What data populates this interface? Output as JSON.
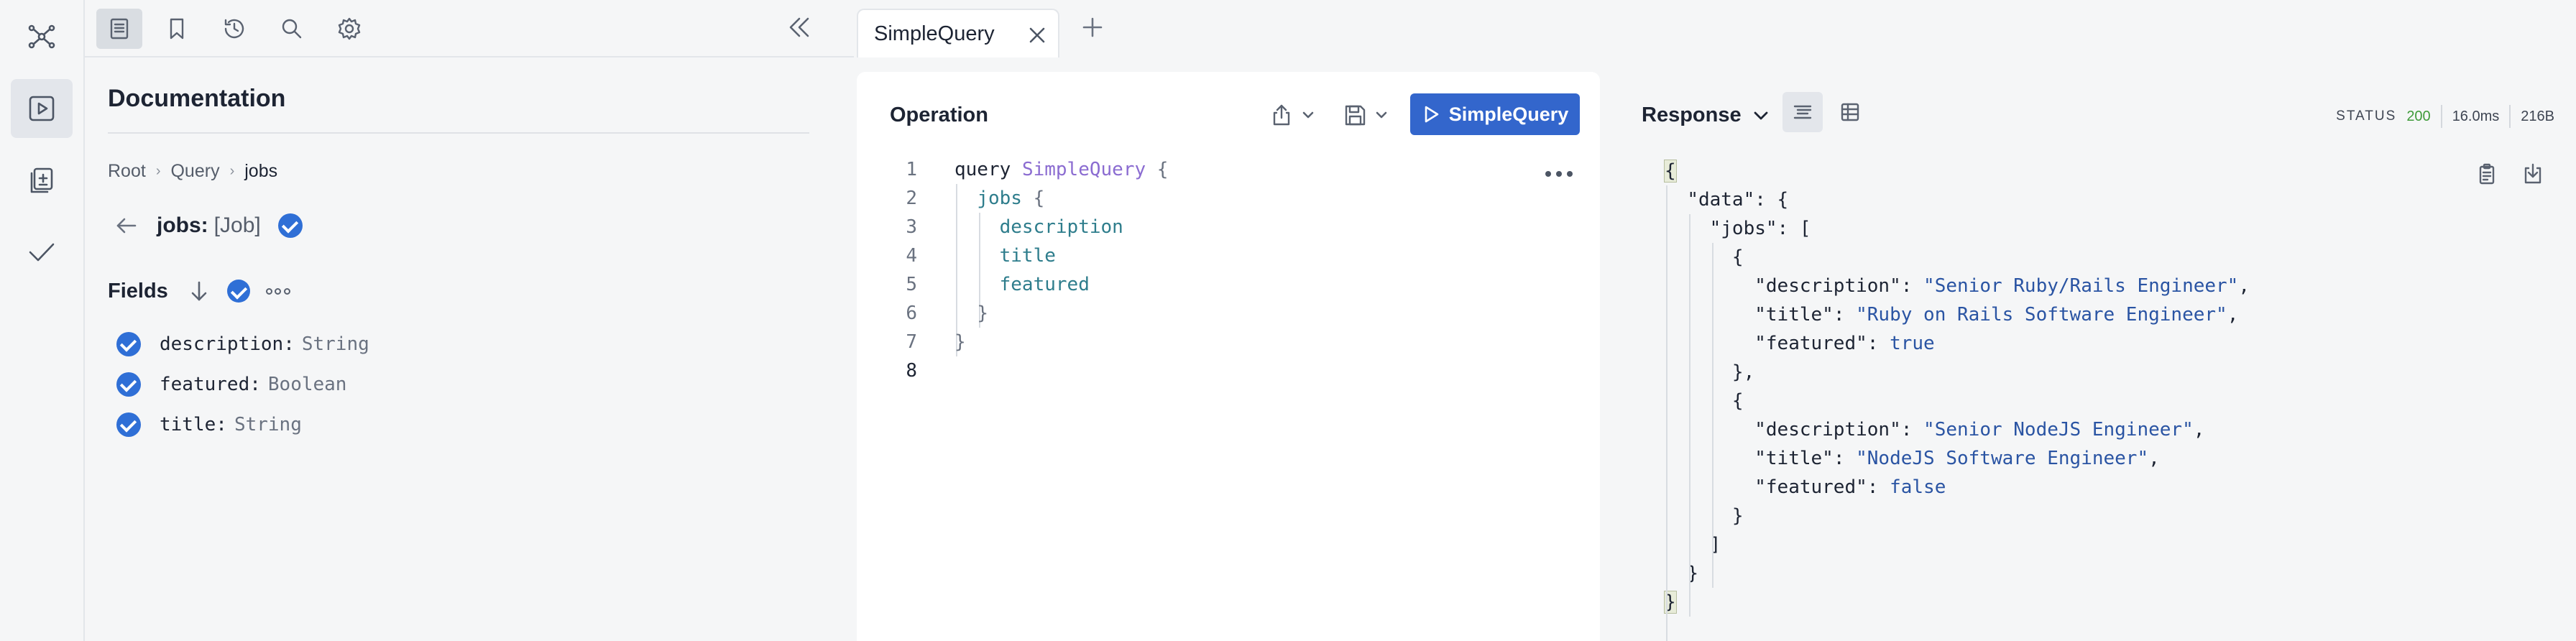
{
  "rail": {
    "items": [
      {
        "icon": "graph-icon"
      },
      {
        "icon": "play-icon",
        "active": true
      },
      {
        "icon": "collection-icon"
      },
      {
        "icon": "check-icon"
      }
    ]
  },
  "docs_toolbar": {
    "buttons": [
      "docs-icon",
      "bookmark-icon",
      "history-icon",
      "search-icon",
      "settings-icon"
    ]
  },
  "docs": {
    "title": "Documentation",
    "breadcrumb": [
      "Root",
      "Query",
      "jobs"
    ],
    "field_name": "jobs:",
    "field_type": "[Job]",
    "fields_heading": "Fields",
    "fields": [
      {
        "name": "description",
        "type": "String"
      },
      {
        "name": "featured",
        "type": "Boolean"
      },
      {
        "name": "title",
        "type": "String"
      }
    ]
  },
  "tabs": [
    {
      "label": "SimpleQuery"
    }
  ],
  "operation": {
    "title": "Operation",
    "run_label": "SimpleQuery",
    "line_numbers": [
      "1",
      "2",
      "3",
      "4",
      "5",
      "6",
      "7",
      "8"
    ],
    "lines": {
      "l1_kw": "query",
      "l1_name": "SimpleQuery",
      "l1_brace": "{",
      "l2_field": "jobs",
      "l2_brace": "{",
      "l3": "description",
      "l4": "title",
      "l5": "featured",
      "l6": "}",
      "l7": "}"
    }
  },
  "response": {
    "title": "Response",
    "status_label": "STATUS",
    "status_code": "200",
    "time": "16.0ms",
    "size": "216B",
    "json": {
      "open": "{",
      "data_key": "\"data\"",
      "jobs_key": "\"jobs\"",
      "desc_key": "\"description\"",
      "title_key": "\"title\"",
      "featured_key": "\"featured\"",
      "job1_desc": "\"Senior Ruby/Rails Engineer\"",
      "job1_title": "\"Ruby on Rails Software Engineer\"",
      "job1_featured": "true",
      "job2_desc": "\"Senior NodeJS Engineer\"",
      "job2_title": "\"NodeJS Software Engineer\"",
      "job2_featured": "false",
      "close": "}"
    }
  },
  "colors": {
    "accent": "#3366cc",
    "check": "#2f6fd6",
    "status_ok": "#3f9b3a",
    "operation_name": "#8b6cd1",
    "field": "#2e7d8c",
    "json_string": "#2a54a3"
  }
}
